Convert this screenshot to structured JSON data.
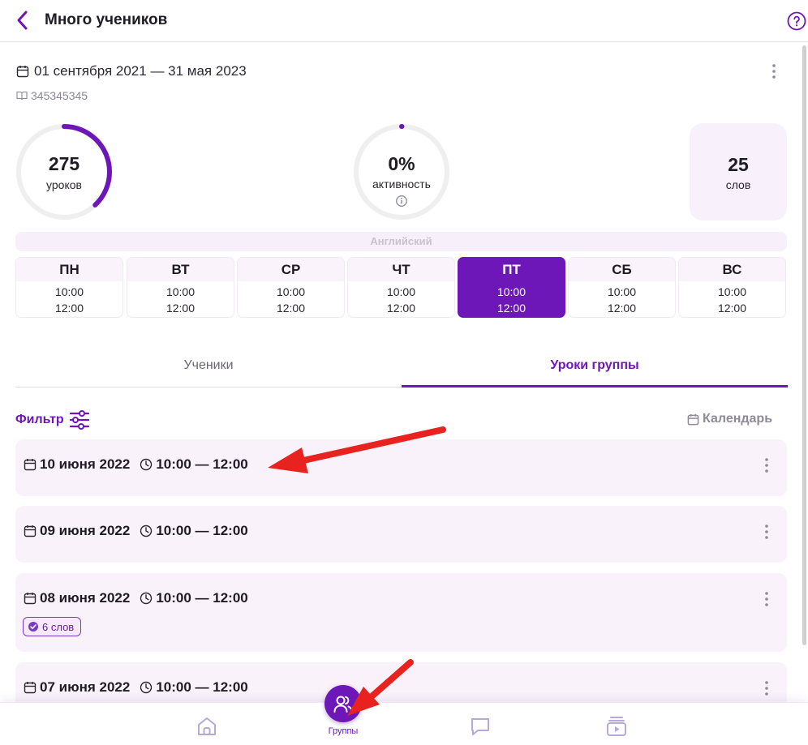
{
  "header": {
    "title": "Много учеников"
  },
  "group": {
    "date_range": "01 сентября 2021 — 31 мая 2023",
    "code": "345345345"
  },
  "stats": {
    "lessons": {
      "value": "275",
      "label": "уроков",
      "progress": 0.38
    },
    "activity": {
      "value": "0%",
      "label": "активность",
      "progress": 0.0
    },
    "words": {
      "value": "25",
      "label": "слов"
    }
  },
  "language": "Английский",
  "schedule": [
    {
      "day": "ПН",
      "start": "10:00",
      "end": "12:00",
      "active": false
    },
    {
      "day": "ВТ",
      "start": "10:00",
      "end": "12:00",
      "active": false
    },
    {
      "day": "СР",
      "start": "10:00",
      "end": "12:00",
      "active": false
    },
    {
      "day": "ЧТ",
      "start": "10:00",
      "end": "12:00",
      "active": false
    },
    {
      "day": "ПТ",
      "start": "10:00",
      "end": "12:00",
      "active": true
    },
    {
      "day": "СБ",
      "start": "10:00",
      "end": "12:00",
      "active": false
    },
    {
      "day": "ВС",
      "start": "10:00",
      "end": "12:00",
      "active": false
    }
  ],
  "tabs": {
    "students": "Ученики",
    "lessons": "Уроки группы"
  },
  "toolbar": {
    "filter": "Фильтр",
    "calendar": "Календарь"
  },
  "lessons": [
    {
      "date": "10 июня 2022",
      "time": "10:00 — 12:00"
    },
    {
      "date": "09 июня 2022",
      "time": "10:00 — 12:00"
    },
    {
      "date": "08 июня 2022",
      "time": "10:00 — 12:00",
      "badge": "6 слов"
    },
    {
      "date": "07 июня 2022",
      "time": "10:00 — 12:00"
    }
  ],
  "bottom_nav": {
    "groups_label": "Группы"
  },
  "colors": {
    "accent": "#6d17b8",
    "card": "#f9f2fa",
    "annotation": "#e8231f"
  }
}
